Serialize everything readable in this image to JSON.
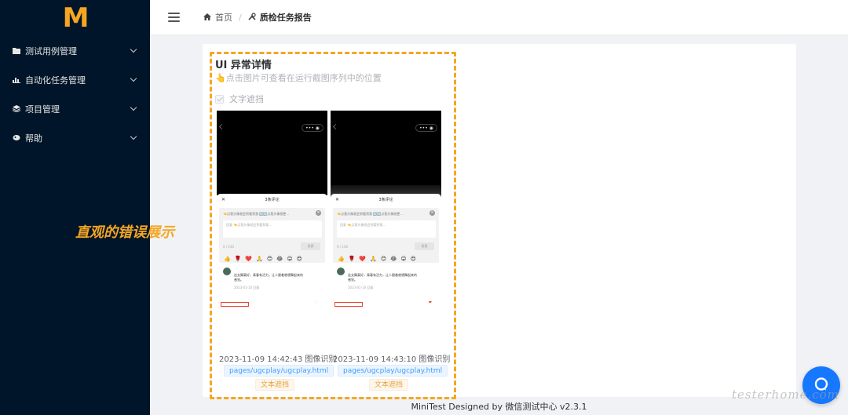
{
  "sidebar": {
    "logo": "M",
    "items": [
      {
        "label": "测试用例管理",
        "icon": "folder-icon"
      },
      {
        "label": "自动化任务管理",
        "icon": "bar-chart-icon"
      },
      {
        "label": "项目管理",
        "icon": "layers-icon"
      },
      {
        "label": "帮助",
        "icon": "help-icon"
      }
    ]
  },
  "header": {
    "breadcrumb_home": "首页",
    "breadcrumb_separator": "/",
    "breadcrumb_current": "质检任务报告"
  },
  "card": {
    "title": "UI 异常详情",
    "hint": "👆点击图片可查看在运行截图序列中的位置",
    "checkbox_label": "文字遮挡"
  },
  "shots": [
    {
      "time": "2023-11-09 14:42:43 图像识别",
      "page": "pages/ugcplay/ugcplay.html",
      "issue": "文本遮挡",
      "sheet_title": "3条评论",
      "line1": "👈点我头像就会到看到我 🔃🔃点我头像就更...",
      "placeholder": "回复 👈点我头像就会到看到我...",
      "count": "0 / 140",
      "send": "发表",
      "emoji": "👍🌹❤️🙏😊😂😛😍",
      "comment": "这支舞真好，青春有活力，让人跟着就想舞起来的感觉。",
      "comment_meta": "2023-01-10  回复"
    },
    {
      "time": "2023-11-09 14:43:10 图像识别",
      "page": "pages/ugcplay/ugcplay.html",
      "issue": "文本遮挡",
      "sheet_title": "3条评论",
      "line1": "👈点我头像就会到看到我 🔃🔃点我头像就更...",
      "placeholder": "回复 👈点我头像就会到看到我...",
      "count": "0 / 140",
      "send": "发表",
      "emoji": "👍🌹❤️🙏😊😂😛😍",
      "comment": "这支舞真好，青春有活力，让人跟着就想舞起来的感觉。",
      "comment_meta": "2023-01-10  回复"
    }
  ],
  "annotation": "直观的错误展示",
  "footer": "MiniTest Designed by 微信测试中心 v2.3.1",
  "watermark": "testerhome.com",
  "colors": {
    "sidebar_bg": "#001529",
    "accent_orange": "#f5a623",
    "chat_blue": "#1677ff",
    "tag_blue": "#409eff",
    "tag_orange": "#e6a23c"
  }
}
